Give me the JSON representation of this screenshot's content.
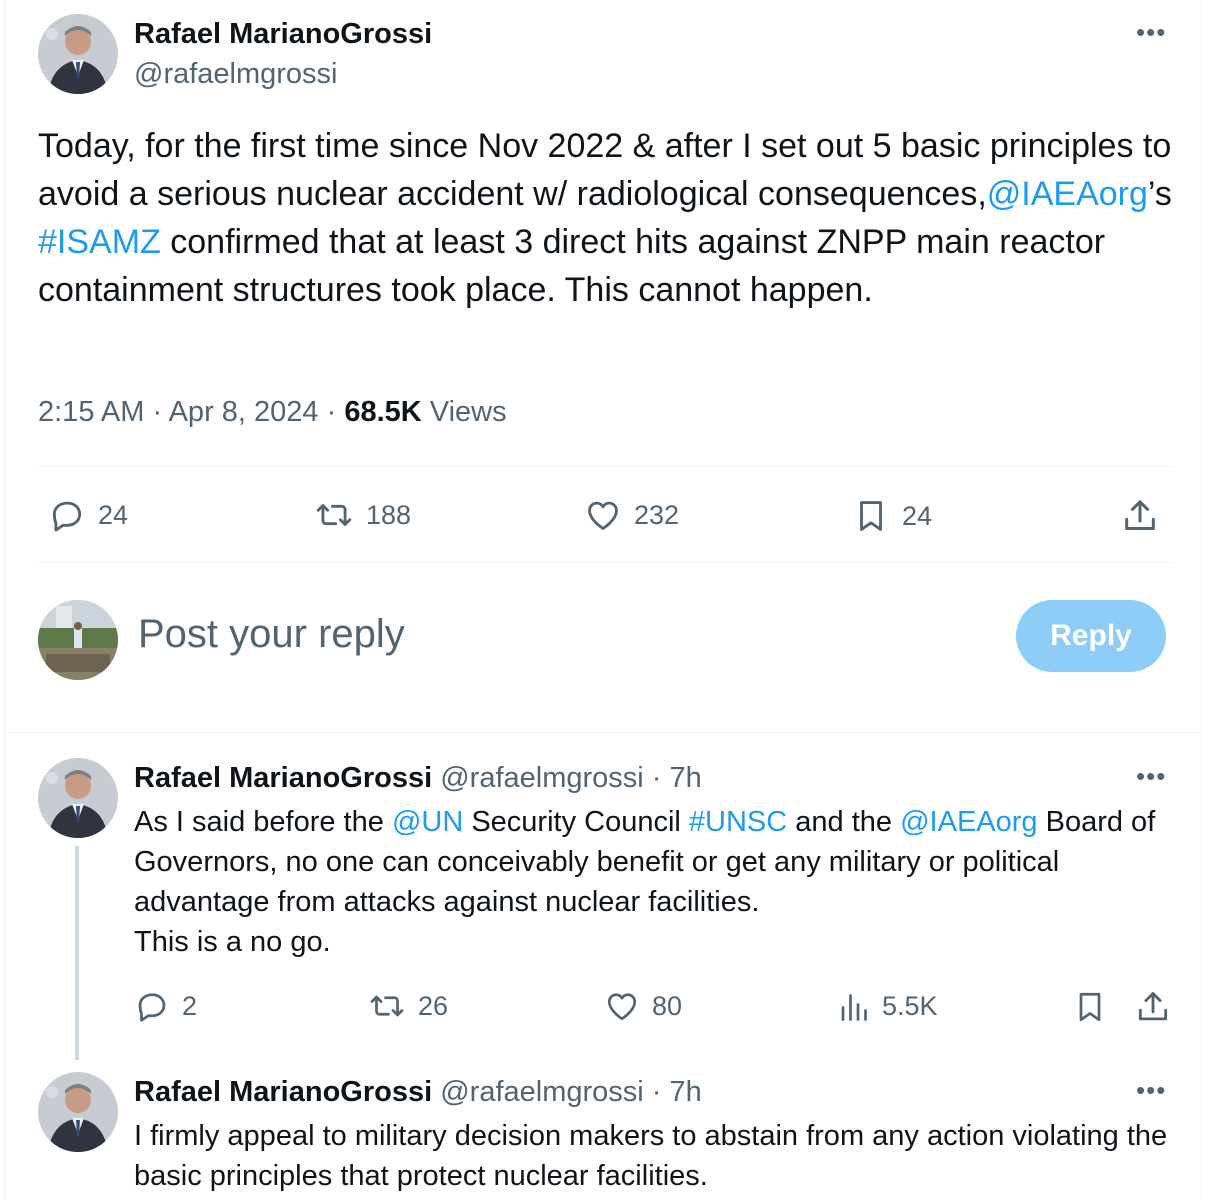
{
  "tweet": {
    "author_name": "Rafael MarianoGrossi",
    "author_handle": "@rafaelmgrossi",
    "text_parts": [
      "Today, for the first time since Nov 2022 & after I set out 5 basic principles to avoid a serious nuclear accident w/ radiological consequences,",
      "@IAEAorg",
      "’s ",
      "#ISAMZ",
      " confirmed that at least 3 direct hits against ZNPP main reactor containment structures took place. This cannot happen."
    ],
    "time": "2:15 AM",
    "date": "Apr 8, 2024",
    "views_count": "68.5K",
    "views_label": "Views",
    "replies": "24",
    "reposts": "188",
    "likes": "232",
    "bookmarks": "24"
  },
  "composer": {
    "placeholder": "Post your reply",
    "reply_button": "Reply"
  },
  "replies": [
    {
      "author_name": "Rafael MarianoGrossi",
      "author_handle": "@rafaelmgrossi",
      "time_ago": "· 7h",
      "text_parts": [
        "As I said before the ",
        "@UN",
        " Security Council ",
        "#UNSC",
        " and the ",
        "@IAEAorg",
        " Board of Governors, no one can conceivably benefit or get any military or political advantage from attacks against nuclear facilities.",
        "This is a no go."
      ],
      "replies": "2",
      "reposts": "26",
      "likes": "80",
      "views": "5.5K"
    },
    {
      "author_name": "Rafael MarianoGrossi",
      "author_handle": "@rafaelmgrossi",
      "time_ago": "· 7h",
      "text": "I firmly appeal to military decision makers to abstain from any action violating the basic principles that protect nuclear facilities."
    }
  ],
  "icons": {
    "more": "more-icon",
    "reply": "reply-icon",
    "repost": "repost-icon",
    "like": "heart-icon",
    "bookmark": "bookmark-icon",
    "share": "share-icon",
    "views": "views-icon"
  },
  "colors": {
    "link": "#1d9bf0",
    "secondary_text": "#536471",
    "reply_button": "#8ecdf8"
  }
}
